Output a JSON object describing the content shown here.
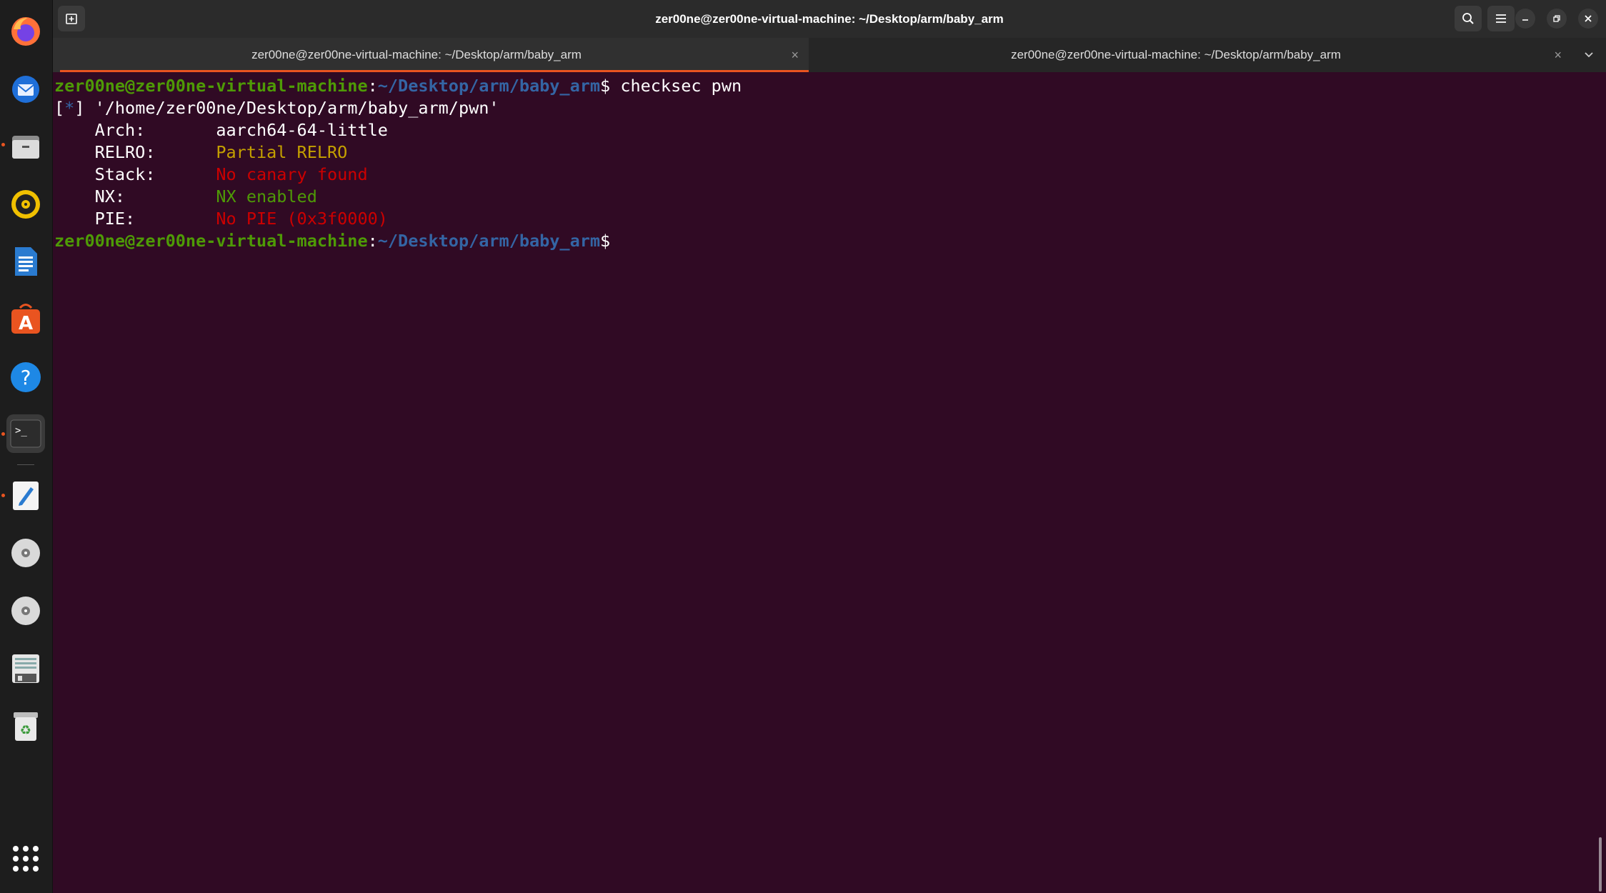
{
  "window": {
    "title": "zer00ne@zer00ne-virtual-machine: ~/Desktop/arm/baby_arm"
  },
  "tabs": [
    {
      "label": "zer00ne@zer00ne-virtual-machine: ~/Desktop/arm/baby_arm",
      "close": "×"
    },
    {
      "label": "zer00ne@zer00ne-virtual-machine: ~/Desktop/arm/baby_arm",
      "close": "×"
    }
  ],
  "dock": {
    "items": [
      "firefox-icon",
      "thunderbird-icon",
      "files-icon",
      "rhythmbox-icon",
      "writer-icon",
      "app-center-icon",
      "help-icon",
      "terminal-icon",
      "text-editor-icon",
      "disc-icon",
      "disc-icon",
      "floppy-icon",
      "trash-icon",
      "show-apps-icon"
    ]
  },
  "terminal": {
    "prompt_user": "zer00ne@zer00ne-virtual-machine",
    "prompt_colon": ":",
    "prompt_path": "~/Desktop/arm/baby_arm",
    "prompt_dollar": "$",
    "command": " checksec pwn",
    "info_open": "[",
    "info_star": "*",
    "info_close": "]",
    "info_text": " '/home/zer00ne/Desktop/arm/baby_arm/pwn'",
    "rows": [
      {
        "key": "    Arch:       ",
        "value": "aarch64-64-little",
        "color": "#ffffff"
      },
      {
        "key": "    RELRO:      ",
        "value": "Partial RELRO",
        "color": "#c4a000"
      },
      {
        "key": "    Stack:      ",
        "value": "No canary found",
        "color": "#cc0000"
      },
      {
        "key": "    NX:         ",
        "value": "NX enabled",
        "color": "#4e9a06"
      },
      {
        "key": "    PIE:        ",
        "value": "No PIE (0x3f0000)",
        "color": "#cc0000"
      }
    ]
  },
  "colors": {
    "background": "#300a24",
    "accent": "#e95420",
    "prompt_user": "#4e9a06",
    "prompt_path": "#3465a4"
  }
}
